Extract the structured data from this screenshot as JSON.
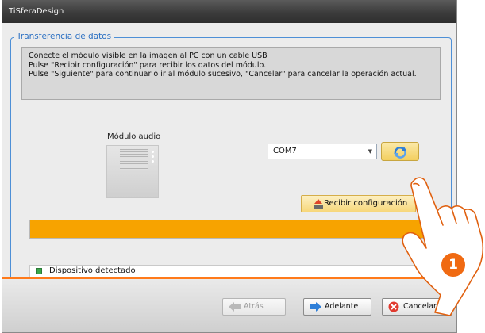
{
  "window": {
    "title": "TiSferaDesign"
  },
  "group": {
    "legend": "Transferencia de datos",
    "instructions": [
      "Conecte el módulo visible en la imagen al PC con un cable USB",
      "Pulse \"Recibir configuración\" para recibir los datos del módulo.",
      "Pulse \"Siguiente\" para continuar o ir al módulo sucesivo, \"Cancelar\" para cancelar la operación actual."
    ]
  },
  "module": {
    "label": "Módulo audio"
  },
  "port": {
    "selected": "COM7"
  },
  "actions": {
    "receive_label": "Recibir configuración"
  },
  "progress": {
    "fraction": 1.0,
    "color": "#f7a300"
  },
  "status": {
    "text": "Dispositivo detectado",
    "led_color": "#3aa84a"
  },
  "footer": {
    "back_label": "Atrás",
    "next_label": "Adelante",
    "cancel_label": "Cancelar"
  },
  "callout": {
    "number": "1"
  },
  "icons": {
    "refresh": "refresh-arrows-icon",
    "receive": "download-to-pc-icon",
    "back": "arrow-left-icon",
    "next": "arrow-right-icon",
    "cancel": "cancel-x-icon",
    "led": "status-led-icon"
  },
  "colors": {
    "accent": "#4d8fd6",
    "separator": "#ff7a1a",
    "callout": "#f06a12"
  }
}
